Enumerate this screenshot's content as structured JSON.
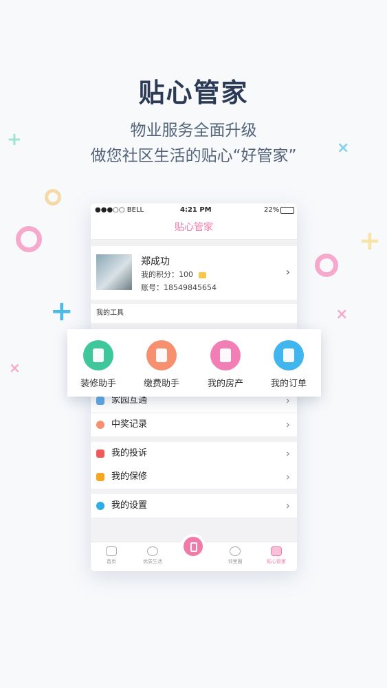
{
  "headline": {
    "title": "贴心管家",
    "subtitle_line1": "物业服务全面升级",
    "subtitle_line2": "做您社区生活的贴心“好管家”"
  },
  "phone": {
    "statusbar": {
      "carrier": "●●●○○ BELL",
      "time": "4:21 PM",
      "battery": "22%"
    },
    "navbar_title": "贴心管家",
    "profile": {
      "name": "郑成功",
      "points_label": "我的积分：100",
      "account_label": "账号：18549845654"
    },
    "tools_header": "我的工具",
    "tools": [
      {
        "label": "装修助手",
        "color": "#3ec79a",
        "icon": "paint-roller-icon"
      },
      {
        "label": "缴费助手",
        "color": "#f7906e",
        "icon": "payment-icon"
      },
      {
        "label": "我的房产",
        "color": "#f17fb6",
        "icon": "building-icon"
      },
      {
        "label": "我的订单",
        "color": "#40b5ee",
        "icon": "price-tag-icon"
      }
    ],
    "menu": [
      {
        "label": "家园互通",
        "color": "#5aa9e6"
      },
      {
        "label": "中奖记录",
        "color": "#f7906e"
      },
      {
        "label": "我的投诉",
        "color": "#ef5b5b"
      },
      {
        "label": "我的保修",
        "color": "#f5a623"
      },
      {
        "label": "我的设置",
        "color": "#2eaee6"
      }
    ],
    "tabs": [
      {
        "label": "首页"
      },
      {
        "label": "优质生活"
      },
      {
        "label": "邻里圈"
      },
      {
        "label": "贴心管家"
      }
    ],
    "accent": "#f27aa8"
  }
}
